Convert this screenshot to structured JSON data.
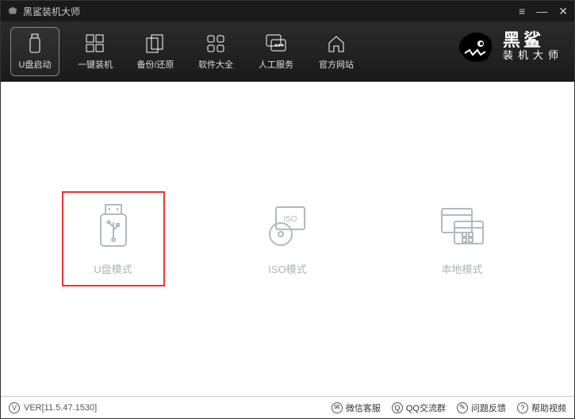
{
  "titlebar": {
    "title": "黑鲨装机大师"
  },
  "nav": {
    "items": [
      {
        "label": "U盘启动"
      },
      {
        "label": "一键装机"
      },
      {
        "label": "备份/还原"
      },
      {
        "label": "软件大全"
      },
      {
        "label": "人工服务"
      },
      {
        "label": "官方网站"
      }
    ]
  },
  "brand": {
    "line1": "黑鲨",
    "line2": "装机大师"
  },
  "modes": {
    "usb": "U盘模式",
    "iso": "ISO模式",
    "local": "本地模式"
  },
  "footer": {
    "version": "VER[11.5.47.1530]",
    "links": {
      "wechat": "微信客服",
      "qq": "QQ交流群",
      "feedback": "问题反馈",
      "help": "帮助视频"
    }
  }
}
